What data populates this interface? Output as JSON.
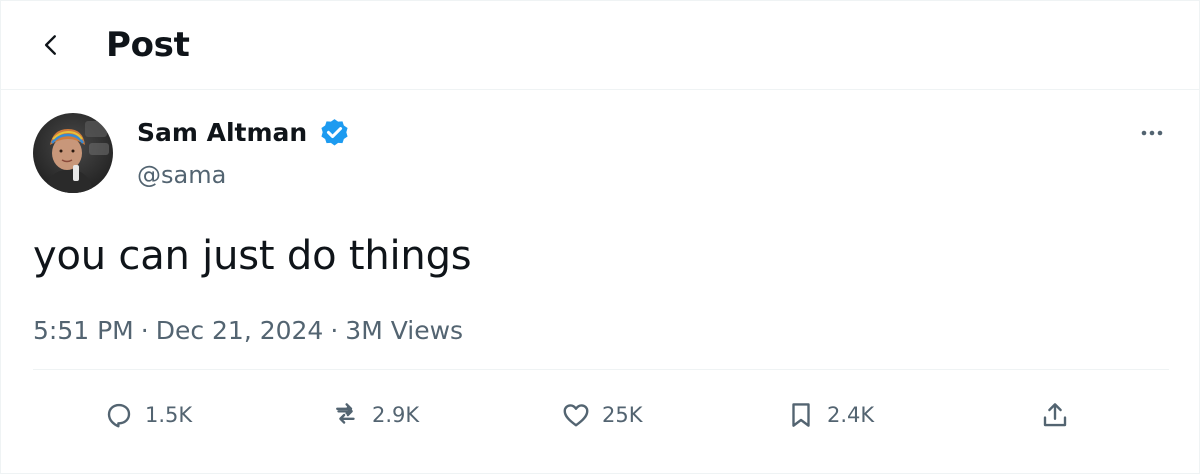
{
  "header": {
    "title": "Post",
    "back_icon": "arrow-left-icon"
  },
  "author": {
    "name": "Sam Altman",
    "handle": "@sama",
    "verified_icon": "verified-badge-icon",
    "verified_color": "#1d9bf0"
  },
  "more_icon": "more-horizontal-icon",
  "tweet": {
    "text": "you can just do things"
  },
  "meta": {
    "time": "5:51 PM",
    "separator": "·",
    "date": "Dec 21, 2024",
    "views": "3M",
    "views_label": "Views"
  },
  "actions": {
    "reply": {
      "icon": "reply-icon",
      "count": "1.5K"
    },
    "retweet": {
      "icon": "retweet-icon",
      "count": "2.9K"
    },
    "like": {
      "icon": "heart-icon",
      "count": "25K"
    },
    "bookmark": {
      "icon": "bookmark-icon",
      "count": "2.4K"
    },
    "share": {
      "icon": "share-icon"
    }
  },
  "colors": {
    "text_primary": "#0f1419",
    "text_secondary": "#536471",
    "border": "#eff3f4",
    "accent": "#1d9bf0"
  }
}
